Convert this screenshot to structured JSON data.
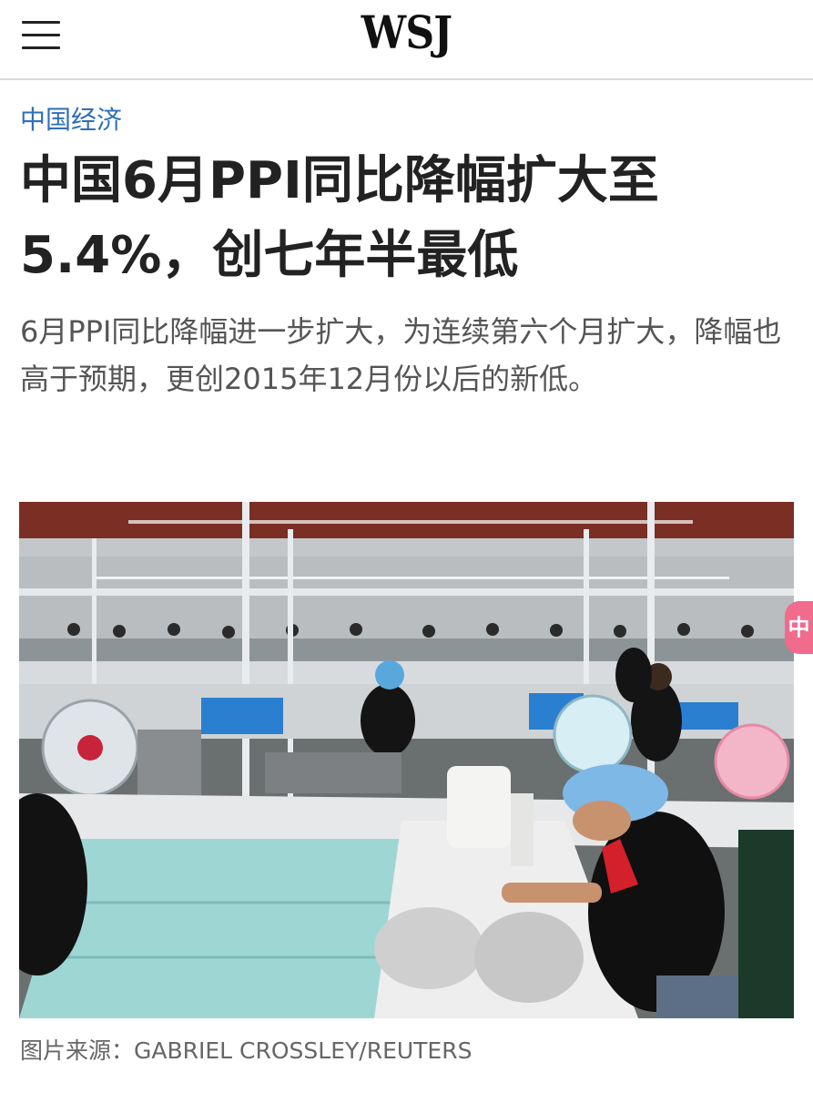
{
  "header": {
    "logo": "WSJ"
  },
  "article": {
    "section": "中国经济",
    "headline": "中国6月PPI同比降幅扩大至5.4%，创七年半最低",
    "dek": "6月PPI同比降幅进一步扩大，为连续第六个月扩大，降幅也高于预期，更创2015年12月份以后的新低。",
    "caption": "图片来源：GABRIEL CROSSLEY/REUTERS"
  },
  "floating_tab": {
    "label": "中"
  },
  "colors": {
    "section_link": "#2f6fb6",
    "headline": "#222222",
    "dek": "#555555",
    "divider": "#d9d9d9",
    "floating_tab": "#f06b8c"
  }
}
